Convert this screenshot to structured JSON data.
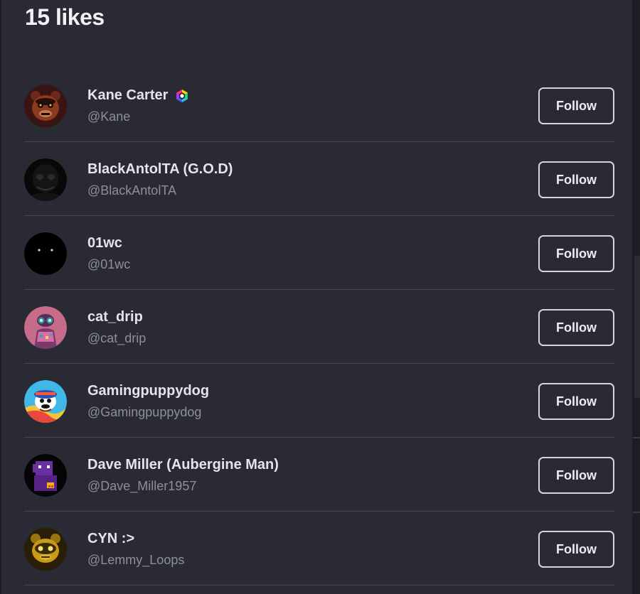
{
  "header": {
    "title": "15 likes"
  },
  "users": [
    {
      "name": "Kane Carter",
      "handle": "@Kane",
      "verified": true,
      "follow_label": "Follow",
      "avatar": "fnaf-freddy-avatar"
    },
    {
      "name": "BlackAntolTA (G.O.D)",
      "handle": "@BlackAntolTA",
      "verified": false,
      "follow_label": "Follow",
      "avatar": "black-figure-avatar"
    },
    {
      "name": "01wc",
      "handle": "@01wc",
      "verified": false,
      "follow_label": "Follow",
      "avatar": "dark-eyes-avatar"
    },
    {
      "name": "cat_drip",
      "handle": "@cat_drip",
      "verified": false,
      "follow_label": "Follow",
      "avatar": "pink-cat-avatar"
    },
    {
      "name": "Gamingpuppydog",
      "handle": "@Gamingpuppydog",
      "verified": false,
      "follow_label": "Follow",
      "avatar": "cartoon-dog-avatar"
    },
    {
      "name": "Dave Miller (Aubergine Man)",
      "handle": "@Dave_Miller1957",
      "verified": false,
      "follow_label": "Follow",
      "avatar": "purple-pixel-man-avatar"
    },
    {
      "name": "CYN :>",
      "handle": "@Lemmy_Loops",
      "verified": false,
      "follow_label": "Follow",
      "avatar": "golden-bear-avatar"
    }
  ],
  "colors": {
    "background": "#292a33",
    "text": "#e3e5ea",
    "muted": "#8e9099",
    "divider": "#43444c",
    "button_border": "#d5d7de"
  }
}
